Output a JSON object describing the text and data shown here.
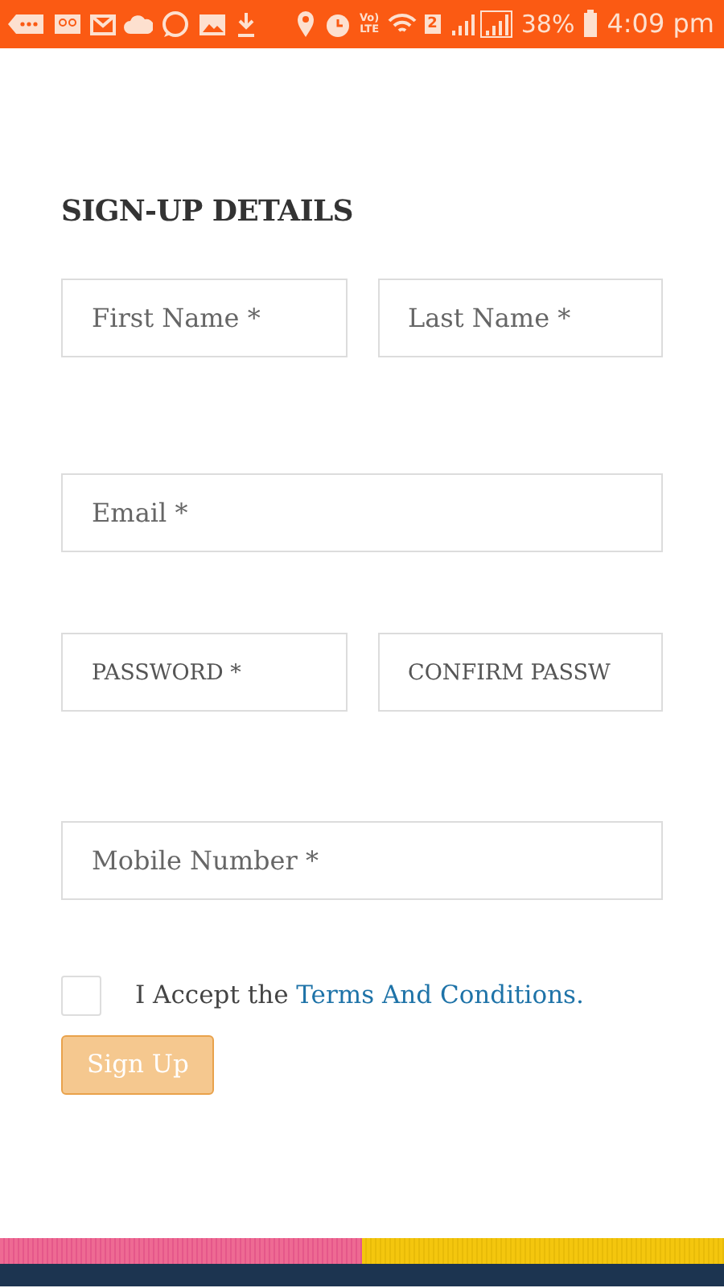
{
  "status_bar": {
    "volte": [
      "Vo)",
      "LTE"
    ],
    "sim_badge": "2",
    "battery": "38%",
    "time": "4:09 pm"
  },
  "heading": "SIGN-UP DETAILS",
  "field_rows": [
    [
      {
        "placeholder": "First Name *",
        "kind": "text"
      },
      {
        "placeholder": "Last Name *",
        "kind": "text"
      }
    ],
    [
      {
        "placeholder": "Email *",
        "kind": "text"
      }
    ],
    [
      {
        "placeholder": "PASSWORD *",
        "kind": "password"
      },
      {
        "placeholder": "CONFIRM PASSW",
        "kind": "password"
      }
    ],
    [
      {
        "placeholder": "Mobile Number *",
        "kind": "text"
      }
    ]
  ],
  "terms": {
    "checked": false,
    "text": "I Accept the ",
    "link": "Terms And Conditions."
  },
  "submit": {
    "label": "Sign Up",
    "disabled": true
  }
}
